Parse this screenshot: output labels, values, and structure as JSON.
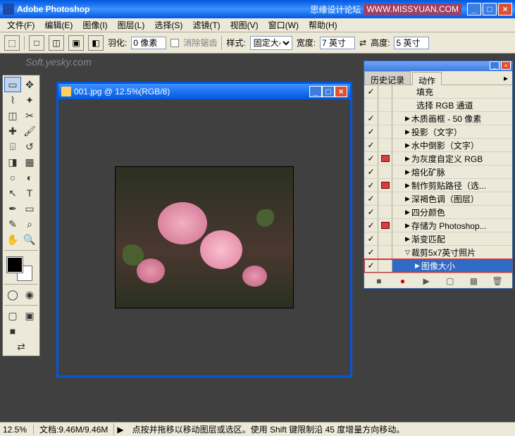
{
  "app": {
    "title": "Adobe Photoshop",
    "forum_text": "思缘设计论坛",
    "forum_url": "WWW.MISSYUAN.COM"
  },
  "menu": {
    "file": "文件(F)",
    "edit": "编辑(E)",
    "image": "图像(I)",
    "layer": "图层(L)",
    "select": "选择(S)",
    "filter": "滤镜(T)",
    "view": "视图(V)",
    "window": "窗口(W)",
    "help": "帮助(H)"
  },
  "options": {
    "feather_label": "羽化:",
    "feather_value": "0 像素",
    "antialias_label": "消除锯齿",
    "style_label": "样式:",
    "style_value": "固定大小",
    "width_label": "宽度:",
    "width_value": "7 英寸",
    "height_label": "高度:",
    "height_value": "5 英寸"
  },
  "watermark": "Soft.yesky.com",
  "document": {
    "title": "001.jpg @ 12.5%(RGB/8)"
  },
  "panel": {
    "tab_history": "历史记录",
    "tab_actions": "动作",
    "actions": [
      {
        "check": true,
        "mod": false,
        "indent": 2,
        "arrow": "",
        "label": "填充"
      },
      {
        "check": false,
        "mod": false,
        "indent": 2,
        "arrow": "",
        "label": "选择 RGB 通道"
      },
      {
        "check": true,
        "mod": false,
        "indent": 1,
        "arrow": "▶",
        "label": "木质画框 - 50 像素"
      },
      {
        "check": true,
        "mod": false,
        "indent": 1,
        "arrow": "▶",
        "label": "投影（文字）"
      },
      {
        "check": true,
        "mod": false,
        "indent": 1,
        "arrow": "▶",
        "label": "水中倒影（文字）"
      },
      {
        "check": true,
        "mod": true,
        "indent": 1,
        "arrow": "▶",
        "label": "为灰度自定义 RGB"
      },
      {
        "check": true,
        "mod": false,
        "indent": 1,
        "arrow": "▶",
        "label": "熔化矿脉"
      },
      {
        "check": true,
        "mod": true,
        "indent": 1,
        "arrow": "▶",
        "label": "制作剪贴路径（选..."
      },
      {
        "check": true,
        "mod": false,
        "indent": 1,
        "arrow": "▶",
        "label": "深褐色调（图层）"
      },
      {
        "check": true,
        "mod": false,
        "indent": 1,
        "arrow": "▶",
        "label": "四分颜色"
      },
      {
        "check": true,
        "mod": true,
        "indent": 1,
        "arrow": "▶",
        "label": "存储为 Photoshop..."
      },
      {
        "check": true,
        "mod": false,
        "indent": 1,
        "arrow": "▶",
        "label": "渐变匹配"
      },
      {
        "check": true,
        "mod": false,
        "indent": 1,
        "arrow": "▽",
        "label": "裁剪5x7英寸照片"
      },
      {
        "check": true,
        "mod": false,
        "indent": 2,
        "arrow": "▶",
        "label": "图像大小",
        "selected": true,
        "highlighted": true
      }
    ]
  },
  "status": {
    "zoom": "12.5%",
    "doc": "文档:9.46M/9.46M",
    "hint": "点按并拖移以移动图层或选区。使用 Shift 键限制沿 45 度增量方向移动。"
  },
  "colors": {
    "titlebar_blue": "#0058e0",
    "selection_blue": "#316ac5",
    "highlight_red": "#e03030"
  }
}
